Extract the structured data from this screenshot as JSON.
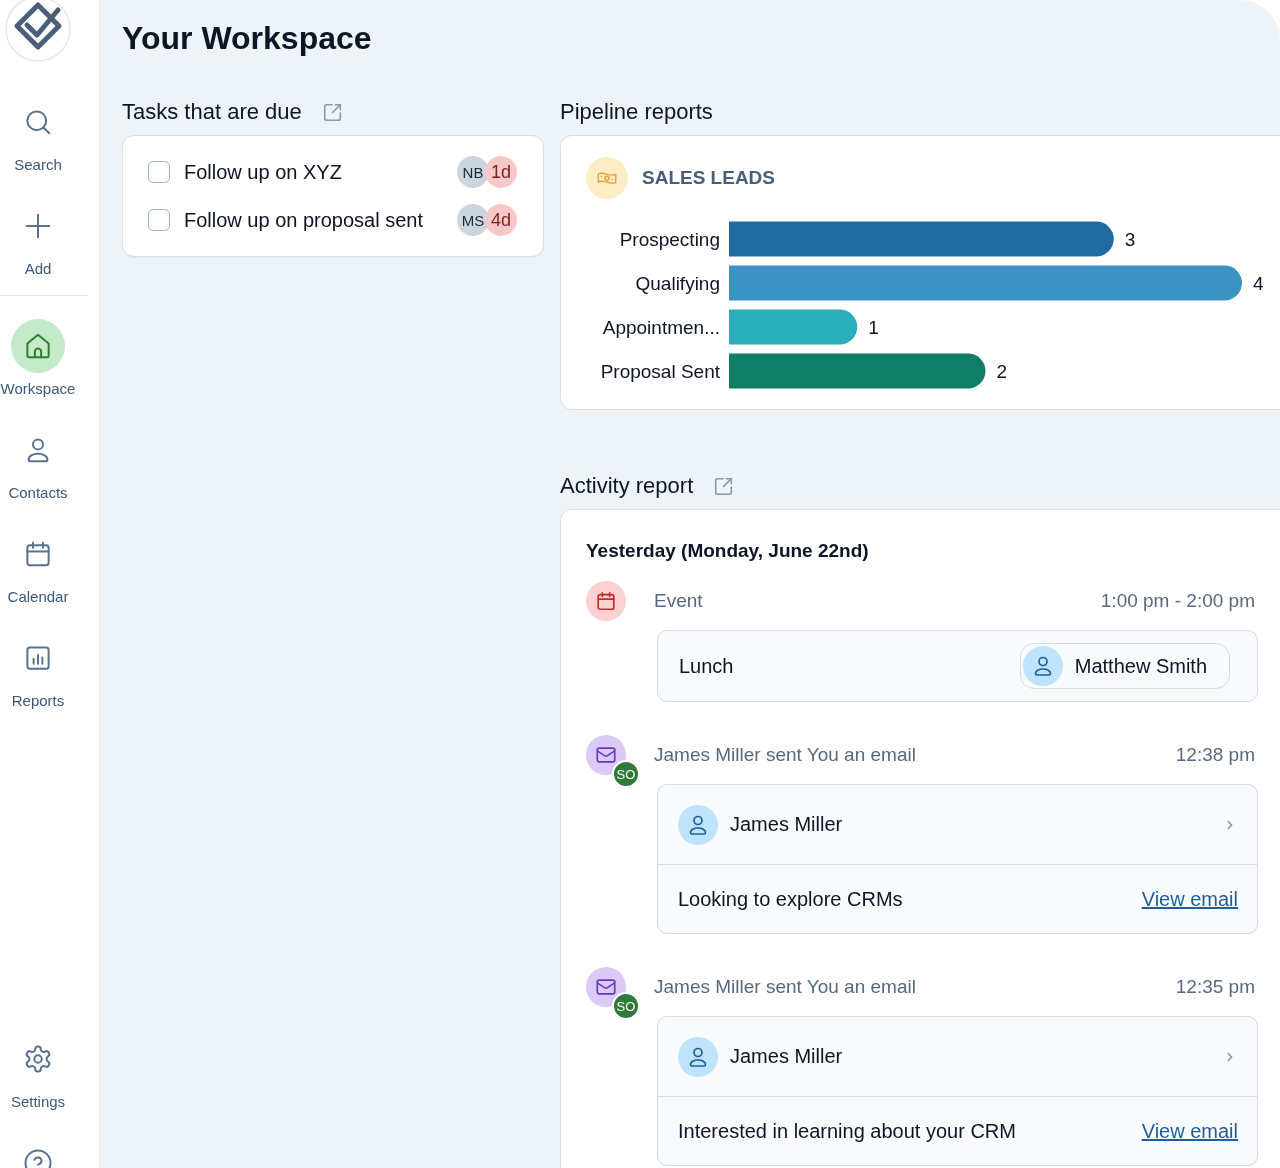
{
  "sidebar": {
    "actions": [
      {
        "label": "Search"
      },
      {
        "label": "Add"
      }
    ],
    "nav_items": [
      {
        "label": "Workspace",
        "selected": true
      },
      {
        "label": "Contacts",
        "selected": false
      },
      {
        "label": "Calendar",
        "selected": false
      },
      {
        "label": "Reports",
        "selected": false
      }
    ],
    "footer_items": [
      {
        "label": "Settings"
      }
    ]
  },
  "title": "Your Workspace",
  "tasks": {
    "title": "Tasks that are due",
    "items": [
      {
        "label": "Follow up on XYZ",
        "checked": false,
        "assignee": "NB",
        "due": "1d"
      },
      {
        "label": "Follow up on proposal sent",
        "checked": false,
        "assignee": "MS",
        "due": "4d"
      }
    ]
  },
  "pipeline": {
    "title": "Pipeline reports",
    "chart_data": {
      "type": "bar",
      "orientation": "horizontal",
      "title": "SALES LEADS",
      "categories": [
        "Prospecting",
        "Qualifying",
        "Appointmen...",
        "Proposal Sent"
      ],
      "values": [
        3,
        4,
        1,
        2
      ],
      "data_labels": true
    }
  },
  "activity": {
    "title": "Activity report",
    "date_heading": "Yesterday (Monday, June 22nd)",
    "entries": [
      {
        "kind": "event",
        "title": "Event",
        "time": "1:00 pm - 2:00 pm",
        "subject": "Lunch",
        "attendee": "Matthew Smith"
      },
      {
        "kind": "email",
        "title": "James Miller sent You an email",
        "time": "12:38 pm",
        "badge": "SO",
        "contact": "James Miller",
        "preview": "Looking to explore CRMs",
        "link": "View email"
      },
      {
        "kind": "email",
        "title": "James Miller sent You an email",
        "time": "12:35 pm",
        "badge": "SO",
        "contact": "James Miller",
        "preview": "Interested in learning about your CRM",
        "link": "View email"
      }
    ]
  }
}
